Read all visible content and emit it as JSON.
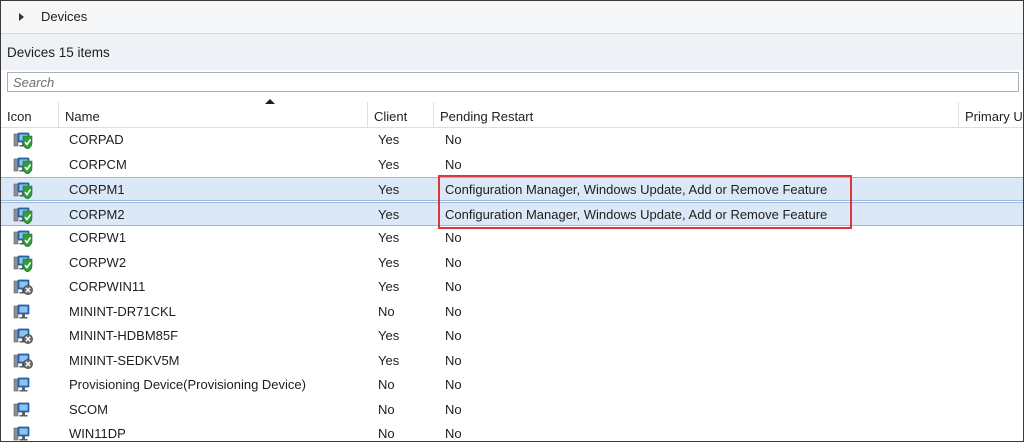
{
  "breadcrumb": {
    "current": "Devices"
  },
  "panel": {
    "title": "Devices 15 items"
  },
  "search": {
    "placeholder": "Search"
  },
  "columns": [
    "Icon",
    "Name",
    "Client",
    "Pending Restart",
    "Primary U"
  ],
  "rows": [
    {
      "icon": "device-ok-icon",
      "name": "CORPAD",
      "client": "Yes",
      "pending_restart": "No"
    },
    {
      "icon": "device-ok-icon",
      "name": "CORPCM",
      "client": "Yes",
      "pending_restart": "No"
    },
    {
      "icon": "device-ok-icon",
      "name": "CORPM1",
      "client": "Yes",
      "pending_restart": "Configuration Manager, Windows Update, Add or Remove Feature",
      "selected": true
    },
    {
      "icon": "device-ok-icon",
      "name": "CORPM2",
      "client": "Yes",
      "pending_restart": "Configuration Manager, Windows Update, Add or Remove Feature",
      "selected": true
    },
    {
      "icon": "device-ok-icon",
      "name": "CORPW1",
      "client": "Yes",
      "pending_restart": "No"
    },
    {
      "icon": "device-ok-icon",
      "name": "CORPW2",
      "client": "Yes",
      "pending_restart": "No"
    },
    {
      "icon": "device-error-icon",
      "name": "CORPWIN11",
      "client": "Yes",
      "pending_restart": "No"
    },
    {
      "icon": "device-plain-icon",
      "name": "MININT-DR71CKL",
      "client": "No",
      "pending_restart": "No"
    },
    {
      "icon": "device-error-icon",
      "name": "MININT-HDBM85F",
      "client": "Yes",
      "pending_restart": "No"
    },
    {
      "icon": "device-error-icon",
      "name": "MININT-SEDKV5M",
      "client": "Yes",
      "pending_restart": "No"
    },
    {
      "icon": "device-plain-icon",
      "name": "Provisioning Device(Provisioning Device)",
      "client": "No",
      "pending_restart": "No"
    },
    {
      "icon": "device-plain-icon",
      "name": "SCOM",
      "client": "No",
      "pending_restart": "No"
    },
    {
      "icon": "device-plain-icon",
      "name": "WIN11DP",
      "client": "No",
      "pending_restart": "No"
    }
  ],
  "colors": {
    "selection": "#dbe8f7",
    "highlight_border": "#d9363e",
    "ok_badge": "#2f9e3a",
    "error_badge": "#6b6b6b",
    "monitor": "#2f6fb8"
  }
}
